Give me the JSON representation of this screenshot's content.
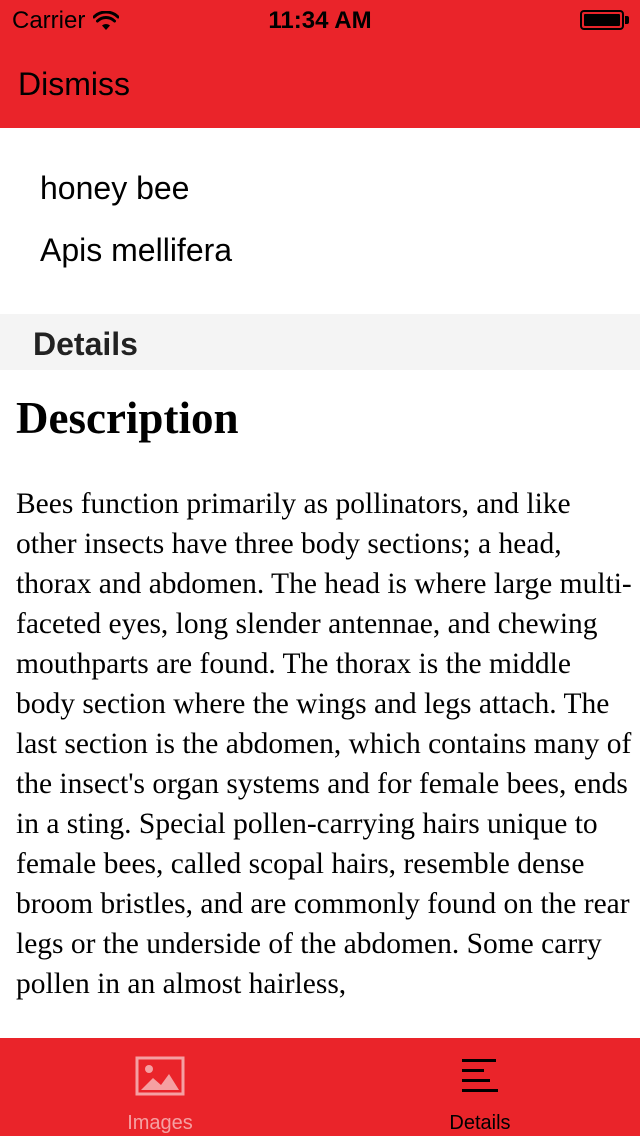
{
  "status_bar": {
    "carrier": "Carrier",
    "time": "11:34 AM"
  },
  "nav": {
    "dismiss_label": "Dismiss"
  },
  "species": {
    "common_name": "honey bee",
    "scientific_name": "Apis mellifera"
  },
  "section": {
    "title": "Details"
  },
  "description": {
    "heading": "Description",
    "body": "Bees function primarily as pollinators, and like other insects have three body sections; a head, thorax and abdomen. The head is where large multi-faceted eyes, long slender antennae, and chewing mouthparts are found. The thorax is the middle body section where the wings and legs attach. The last section is the abdomen, which contains many of the insect's organ systems and for female bees, ends in a sting. Special pollen-carrying hairs unique to female bees, called scopal hairs, resemble dense broom bristles, and are commonly found on the rear legs or the underside of the abdomen. Some carry pollen in an almost hairless,"
  },
  "tab_bar": {
    "tabs": [
      {
        "label": "Images",
        "icon": "image-icon",
        "selected": false
      },
      {
        "label": "Details",
        "icon": "details-lines-icon",
        "selected": true
      }
    ]
  },
  "colors": {
    "accent": "#EA242A",
    "section_bg": "#F4F4F4",
    "tab_inactive": "#F5A0A2"
  }
}
